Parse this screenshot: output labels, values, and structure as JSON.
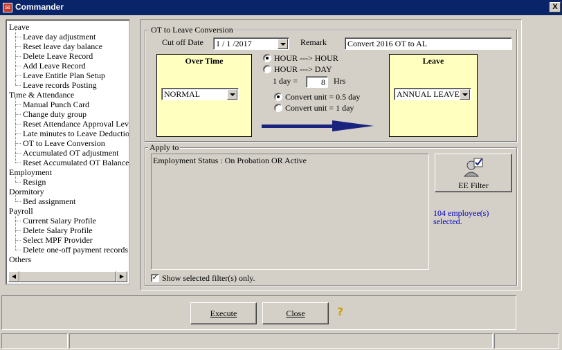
{
  "window": {
    "title": "Commander",
    "close_label": "X"
  },
  "tree": {
    "nodes": [
      {
        "label": "Leave",
        "level": 0
      },
      {
        "label": "Leave day adjustment",
        "level": 1
      },
      {
        "label": "Reset leave day balance",
        "level": 1
      },
      {
        "label": "Delete Leave Record",
        "level": 1
      },
      {
        "label": "Add Leave Record",
        "level": 1
      },
      {
        "label": "Leave Entitle Plan Setup",
        "level": 1
      },
      {
        "label": "Leave records Posting",
        "level": 1
      },
      {
        "label": "Time & Attendance",
        "level": 0
      },
      {
        "label": "Manual Punch Card",
        "level": 1
      },
      {
        "label": "Change duty group",
        "level": 1
      },
      {
        "label": "Reset Attendance Approval Leve",
        "level": 1
      },
      {
        "label": "Late minutes to Leave Deduction",
        "level": 1
      },
      {
        "label": "OT to Leave Conversion",
        "level": 1
      },
      {
        "label": "Accumulated OT adjustment",
        "level": 1
      },
      {
        "label": "Reset Accumulated OT Balance",
        "level": 1
      },
      {
        "label": "Employment",
        "level": 0
      },
      {
        "label": "Resign",
        "level": 1
      },
      {
        "label": "Dormitory",
        "level": 0
      },
      {
        "label": "Bed assignment",
        "level": 1
      },
      {
        "label": "Payroll",
        "level": 0
      },
      {
        "label": "Current Salary Profile",
        "level": 1
      },
      {
        "label": "Delete Salary Profile",
        "level": 1
      },
      {
        "label": "Select MPF Provider",
        "level": 1
      },
      {
        "label": "Delete one-off payment records",
        "level": 1
      },
      {
        "label": "Others",
        "level": 0
      }
    ]
  },
  "conversion": {
    "group_title": "OT to Leave Conversion",
    "cutoff_label": "Cut off Date",
    "cutoff_value": "1 / 1 /2017",
    "remark_label": "Remark",
    "remark_value": "Convert 2016 OT to AL",
    "overtime_title": "Over Time",
    "overtime_value": "NORMAL",
    "leave_title": "Leave",
    "leave_value": "ANNUAL LEAVE",
    "radio_hour_hour": "HOUR ---> HOUR",
    "radio_hour_day": "HOUR ---> DAY",
    "one_day_label": "1 day =",
    "one_day_value": "8",
    "hrs_label": "Hrs",
    "unit_half": "Convert unit = 0.5 day",
    "unit_one": "Convert unit = 1 day"
  },
  "apply_to": {
    "group_title": "Apply to",
    "filter_text": "Employment Status : On Probation OR Active",
    "filter_button": "EE Filter",
    "selected_count": "104 employee(s) selected.",
    "show_selected_label": "Show selected filter(s) only."
  },
  "actions": {
    "execute_label": "Execute",
    "close_label": "Close",
    "help_icon": "?"
  },
  "colors": {
    "arrow": "#1a237e",
    "yellow_box": "#ffffc0",
    "link_text": "#0000c0",
    "titlebar": "#0a246a"
  }
}
